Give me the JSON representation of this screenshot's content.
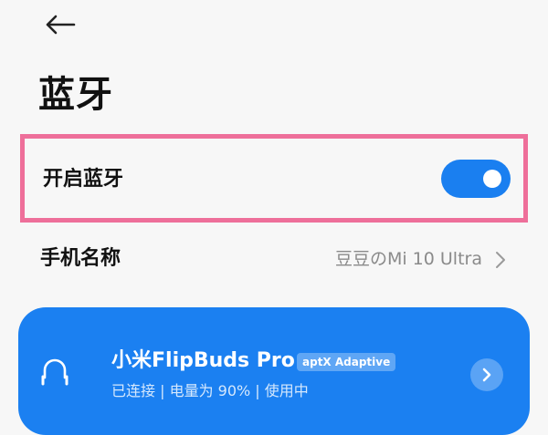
{
  "header": {
    "back_icon": "arrow-left-icon"
  },
  "page": {
    "title": "蓝牙"
  },
  "bluetooth_toggle": {
    "label": "开启蓝牙",
    "enabled": true,
    "accent_color": "#1a7ff0"
  },
  "device_name": {
    "label": "手机名称",
    "value": "豆豆のMi 10 Ultra",
    "chevron_icon": "chevron-right-icon"
  },
  "connected_device": {
    "name": "小米FlipBuds Pro",
    "codec": "aptX Adaptive",
    "status": "已连接 | 电量为 90% | 使用中",
    "icon": "headphone-icon",
    "card_color": "#1b80f1"
  },
  "highlight_color": "#ee6f9a"
}
